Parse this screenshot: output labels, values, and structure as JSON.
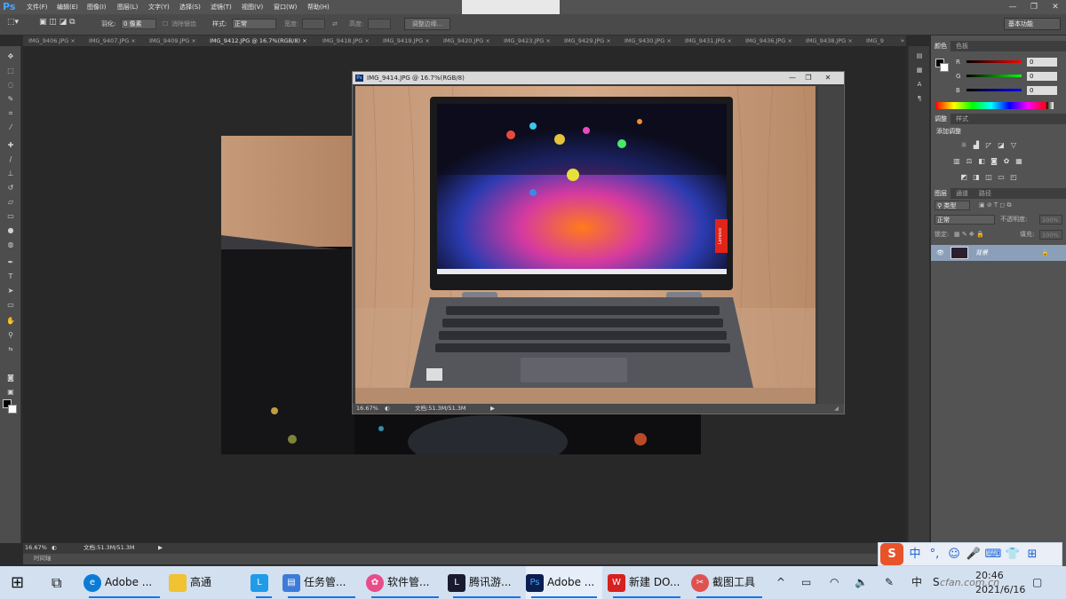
{
  "app": {
    "logo": "Ps",
    "name": "Adobe Photoshop"
  },
  "menu": [
    "文件(F)",
    "编辑(E)",
    "图像(I)",
    "图层(L)",
    "文字(Y)",
    "选择(S)",
    "滤镜(T)",
    "视图(V)",
    "窗口(W)",
    "帮助(H)"
  ],
  "window_controls": [
    "—",
    "❐",
    "✕"
  ],
  "options": {
    "feather_label": "羽化:",
    "feather_value": "0 像素",
    "antialias_label": "消除锯齿",
    "style_label": "样式:",
    "style_value": "正常",
    "width_label": "宽度:",
    "height_label": "高度:",
    "refine_edge": "调整边缘...",
    "workspace": "基本功能"
  },
  "tabs": [
    {
      "label": "IMG_9406.JPG",
      "close": "×"
    },
    {
      "label": "IMG_9407.JPG",
      "close": "×"
    },
    {
      "label": "IMG_9409.JPG",
      "close": "×"
    },
    {
      "label": "IMG_9412.JPG @ 16.7%(RGB/8)",
      "close": "×"
    },
    {
      "label": "IMG_9418.JPG",
      "close": "×"
    },
    {
      "label": "IMG_9419.JPG",
      "close": "×"
    },
    {
      "label": "IMG_9420.JPG",
      "close": "×"
    },
    {
      "label": "IMG_9423.JPG",
      "close": "×"
    },
    {
      "label": "IMG_9429.JPG",
      "close": "×"
    },
    {
      "label": "IMG_9430.JPG",
      "close": "×"
    },
    {
      "label": "IMG_9431.JPG",
      "close": "×"
    },
    {
      "label": "IMG_9436.JPG",
      "close": "×"
    },
    {
      "label": "IMG_9438.JPG",
      "close": "×"
    },
    {
      "label": "IMG_9",
      "close": ""
    }
  ],
  "tabs_more": "»",
  "floating_doc": {
    "title": "IMG_9414.JPG @ 16.7%(RGB/8)",
    "zoom": "16.67%",
    "doc_size": "文档:51.3M/51.3M",
    "laptop_brand": "Lenovo"
  },
  "main_status": {
    "zoom": "16.67%",
    "doc_size": "文档:51.3M/51.3M"
  },
  "timeline_label": "时间轴",
  "color_panel": {
    "tabs": [
      "颜色",
      "色板"
    ],
    "r_label": "R",
    "g_label": "G",
    "b_label": "B",
    "r": "0",
    "g": "0",
    "b": "0"
  },
  "adjust_panel": {
    "tabs": [
      "调整",
      "样式"
    ],
    "title": "添加调整"
  },
  "layers_panel": {
    "tabs": [
      "图层",
      "通道",
      "路径"
    ],
    "kind_filter": "类型",
    "blend_mode": "正常",
    "opacity_label": "不透明度:",
    "opacity_value": "100%",
    "lock_label": "锁定:",
    "fill_label": "填充:",
    "fill_value": "100%",
    "layer_name": "背景"
  },
  "taskbar": {
    "apps": [
      {
        "label": "Adobe ...",
        "icon": "edge-icon",
        "color": "#0b7bd6"
      },
      {
        "label": "高通",
        "icon": "folder-icon",
        "color": "#f1c232"
      },
      {
        "label": "",
        "icon": "l-app-icon",
        "color": "#1e9be9"
      },
      {
        "label": "任务管...",
        "icon": "task-manager-icon",
        "color": "#3d7bd9"
      },
      {
        "label": "软件管...",
        "icon": "software-manager-icon",
        "color": "#e84d8a"
      },
      {
        "label": "腾讯游...",
        "icon": "league-icon",
        "color": "#1a1a2e"
      },
      {
        "label": "Adobe ...",
        "icon": "photoshop-icon",
        "color": "#0a1f4f"
      },
      {
        "label": "新建 DO...",
        "icon": "wps-icon",
        "color": "#d72020"
      },
      {
        "label": "截图工具",
        "icon": "snipping-icon",
        "color": "#e05252"
      }
    ],
    "tray": {
      "chevron": "^",
      "ime": "中",
      "time": "20:46",
      "date": "2021/6/16"
    }
  },
  "ime_bar": {
    "logo": "S",
    "items": [
      "中",
      "°,",
      "☺",
      "🎤",
      "⌨",
      "👕",
      "⊞"
    ]
  },
  "watermark": "cfan.com.cn"
}
